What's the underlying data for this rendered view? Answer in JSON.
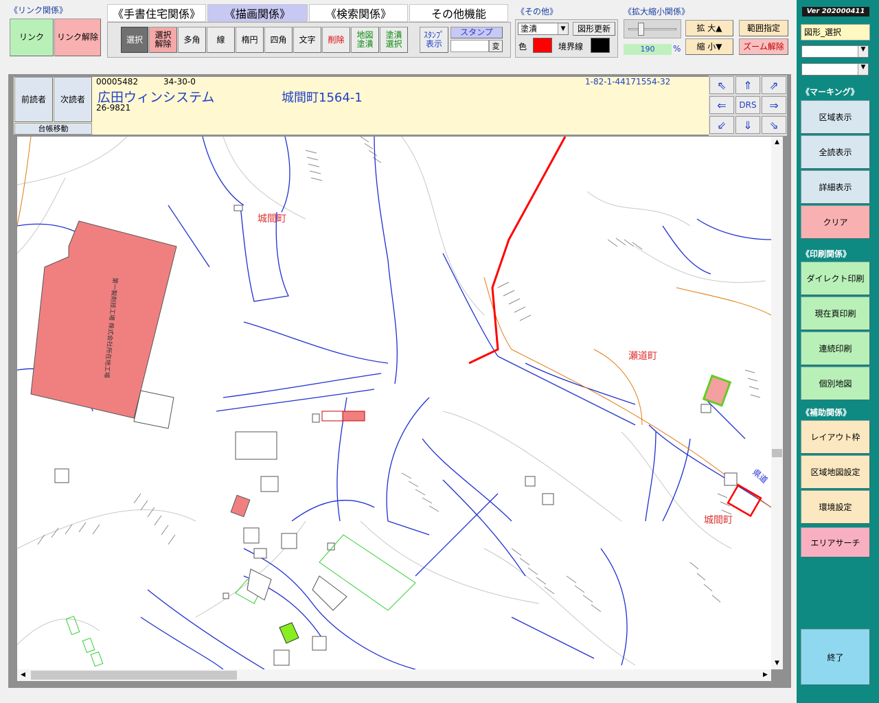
{
  "link_group": {
    "title": "《リンク関係》",
    "link_label": "リンク",
    "unlink_label": "リンク解除"
  },
  "tabs": [
    {
      "label": "《手書住宅関係》"
    },
    {
      "label": "《描画関係》"
    },
    {
      "label": "《検索関係》"
    },
    {
      "label": "その他機能"
    }
  ],
  "draw_tools": {
    "select": "選択",
    "deselect": "選択\n解除",
    "polygon": "多角",
    "line": "線",
    "ellipse": "楕円",
    "rect": "四角",
    "text": "文字",
    "delete": "削除",
    "map_fill": "地図\n塗潰",
    "fill_select": "塗潰\n選択",
    "stamp_show": "ｽﾀﾝﾌﾟ\n表示",
    "stamp_label": "スタンプ",
    "stamp_change": "変"
  },
  "other_group": {
    "title": "《その他》",
    "fill_select_value": "塗潰",
    "update_shape": "図形更新",
    "color_label": "色",
    "border_label": "境界線",
    "fill_color": "#ff0000",
    "border_color": "#000000"
  },
  "zoom_group": {
    "title": "《拡大縮小関係》",
    "zoom_value": "190",
    "percent": "%",
    "zoom_in": "拡 大▲",
    "zoom_out": "縮 小▼",
    "range": "範囲指定",
    "zoom_reset": "ズーム解除"
  },
  "sidebar": {
    "version": "Ver 202000411",
    "mode": "図形_選択",
    "marking_title": "《マーキング》",
    "area_show": "区域表示",
    "all_read": "全読表示",
    "detail_show": "詳細表示",
    "clear": "クリア",
    "print_title": "《印刷関係》",
    "direct_print": "ダイレクト印刷",
    "page_print": "現在頁印刷",
    "continuous_print": "連続印刷",
    "individual_map": "個別地図",
    "aux_title": "《補助関係》",
    "layout_frame": "レイアウト枠",
    "area_map_settings": "区域地図設定",
    "env_settings": "環境設定",
    "area_search": "エリアサーチ",
    "exit": "終了"
  },
  "record": {
    "prev_reader": "前読者",
    "next_reader": "次読者",
    "ledger_move": "台帳移動",
    "id": "00005482",
    "code": "34-30-0",
    "ref": "1-82-1-44171554-32",
    "name": "広田ウィンシステム",
    "address": "城間町1564-1",
    "sub": "26-9821"
  },
  "nav": {
    "drs": "DRS",
    "nw": "⇖",
    "n": "⇑",
    "ne": "⇗",
    "w": "⇐",
    "e": "⇒",
    "sw": "⇙",
    "s": "⇓",
    "se": "⇘"
  },
  "map": {
    "label_town1": "城間町",
    "label_town2": "瀬道町",
    "label_town3": "城間町",
    "label_road": "県道",
    "building_label": "第一製剤技工場 株式会社所在地工場"
  },
  "scroll": {
    "up": "▲",
    "down": "▼",
    "left": "◀",
    "right": "▶"
  },
  "colors": {
    "sidebar_bg": "#0e8a82",
    "header_bg": "#fff8d0",
    "map_road": "#1f2fd0",
    "highlight": "#ff0000",
    "building_fill": "#f08080"
  }
}
